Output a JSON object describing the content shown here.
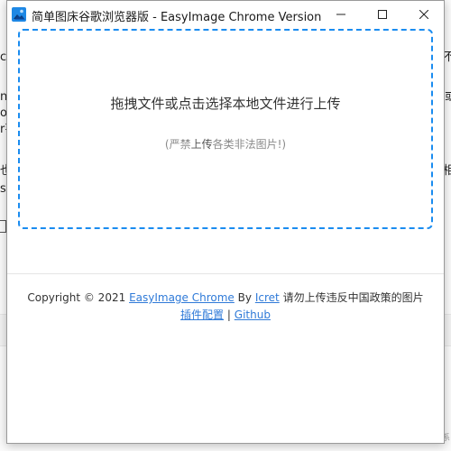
{
  "window": {
    "title": "简单图床谷歌浏览器版 - EasyImage Chrome Version",
    "controls": {
      "minimize": "minimize",
      "maximize": "maximize",
      "close": "close"
    }
  },
  "dropzone": {
    "main_text": "拖拽文件或点击选择本地文件进行上传",
    "sub_prefix": "(严禁",
    "sub_strong": "上传",
    "sub_suffix": "各类非法图片!)"
  },
  "footer": {
    "copyright_prefix": "Copyright © 2021",
    "easyimage_link": "EasyImage Chrome",
    "by_text": "By",
    "author_link": "Icret",
    "notice_text": "请勿上传违反中国政策的图片",
    "config_link": "插件配置",
    "separator": "|",
    "github_link": "Github"
  },
  "background": {
    "frag_1": "ch",
    "frag_2": "nc",
    "frag_3": "o",
    "frag_4": "r芋",
    "frag_5": "也",
    "frag_6": "sy",
    "frag_7": "不",
    "frag_8": "或",
    "frag_9": "相",
    "frag_10": "系"
  },
  "colors": {
    "accent": "#1a8cf0",
    "link": "#2f7ad8"
  }
}
